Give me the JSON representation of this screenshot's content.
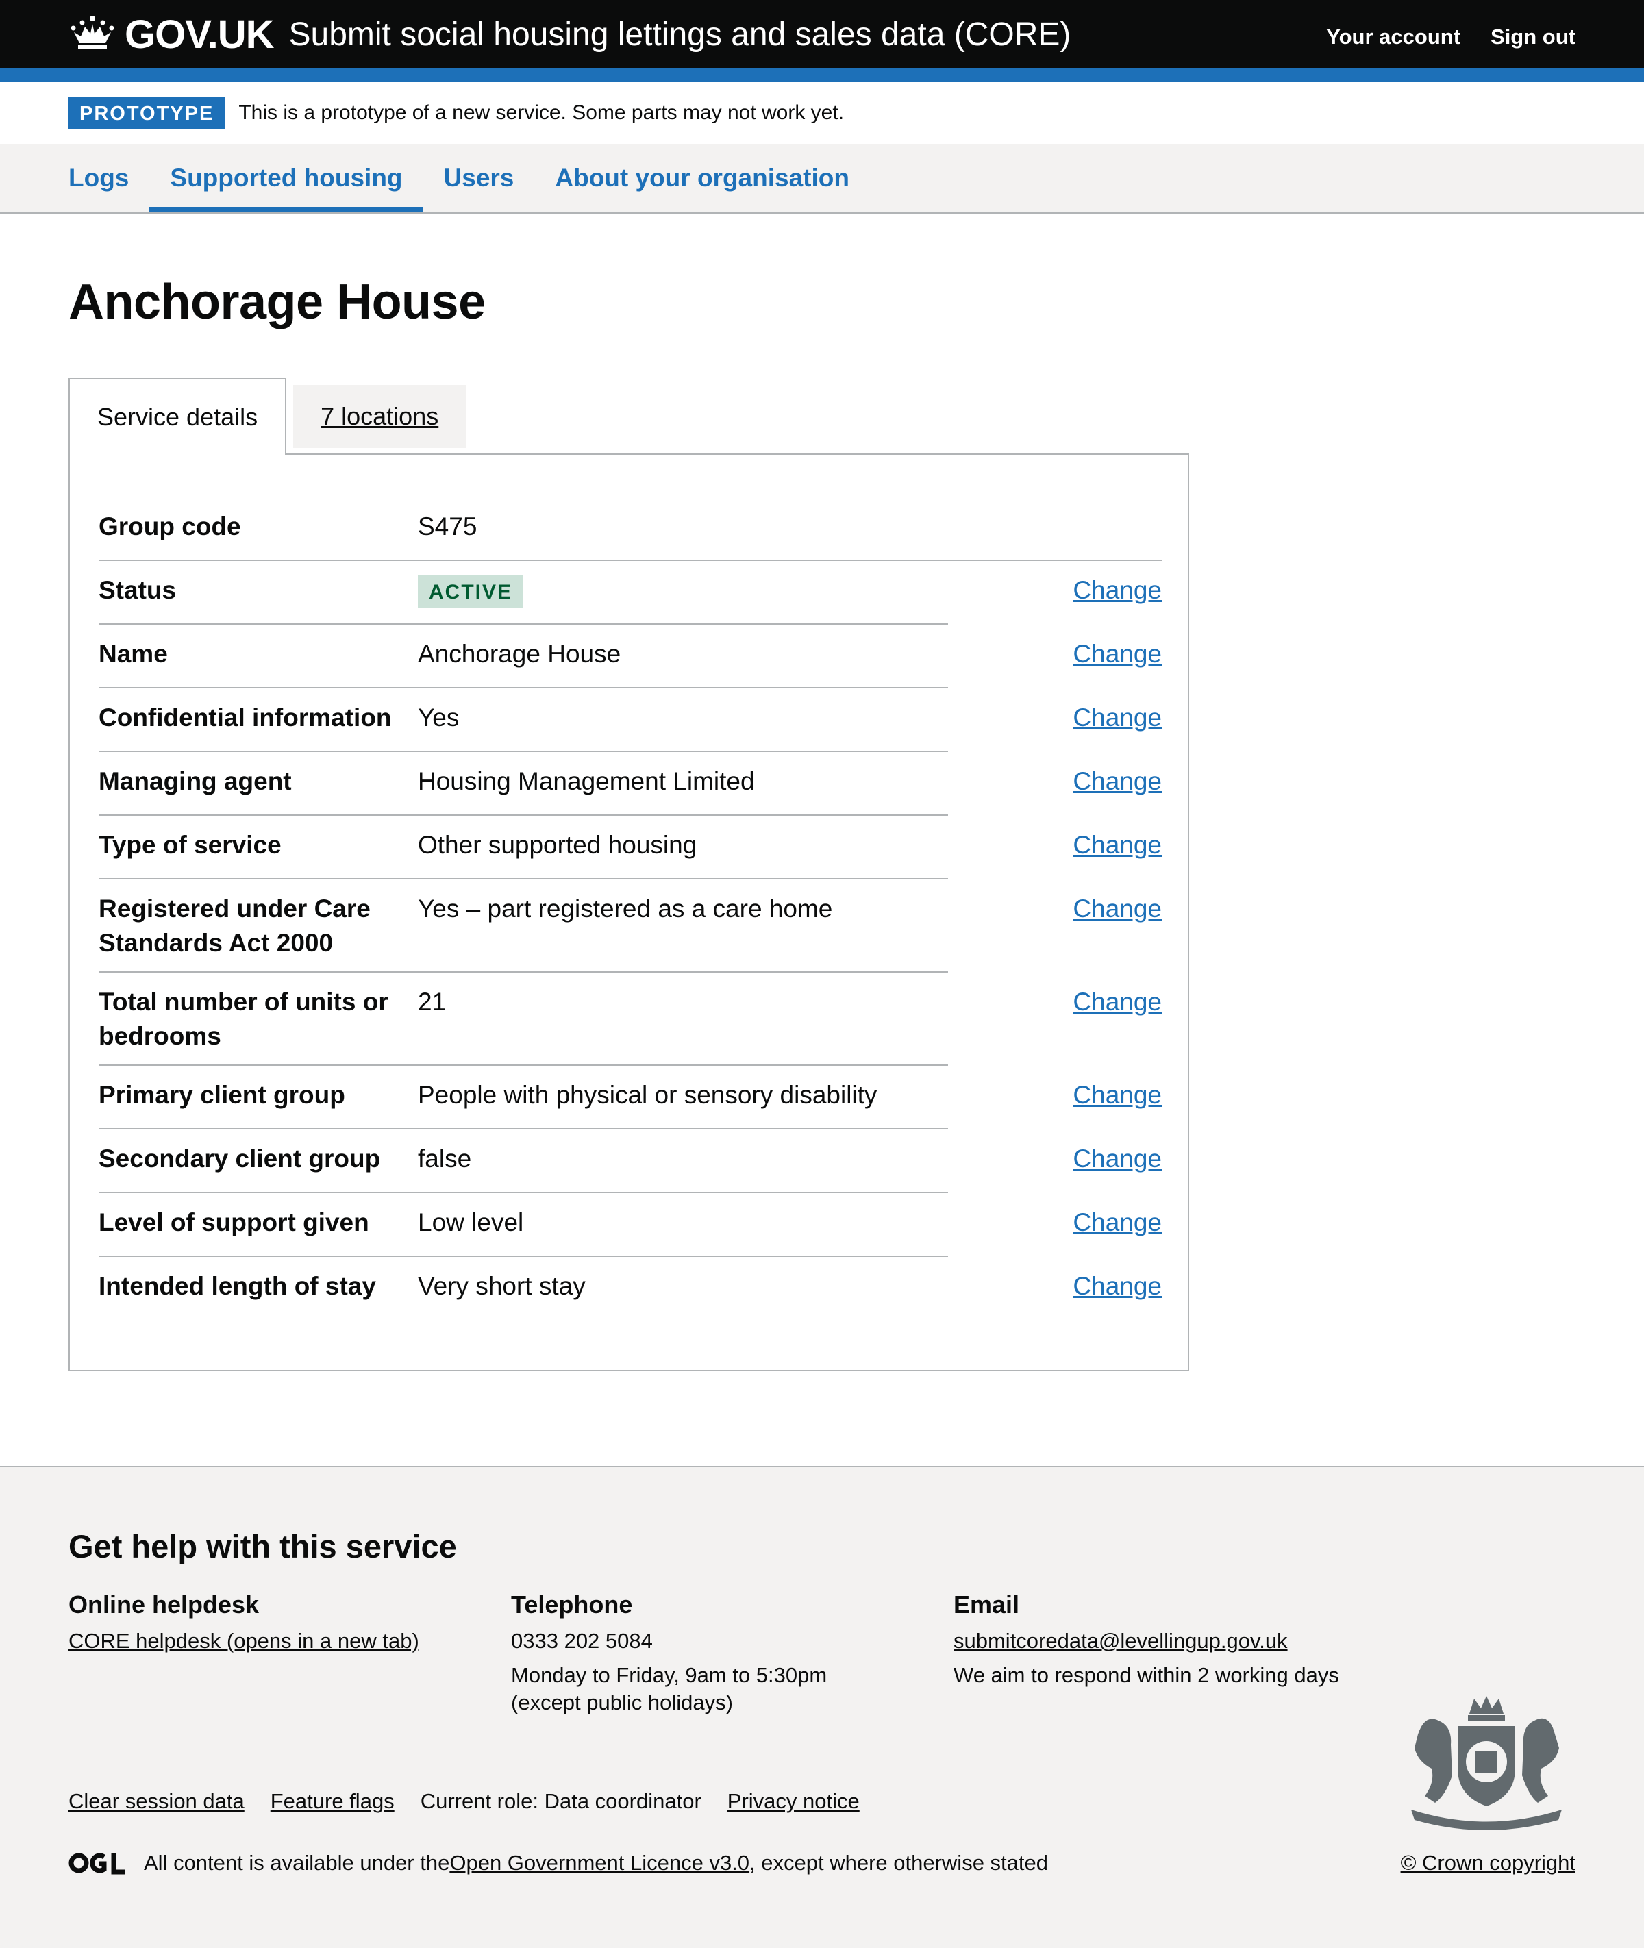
{
  "header": {
    "logo_text": "GOV.UK",
    "service_name": "Submit social housing lettings and sales data (CORE)",
    "links": [
      "Your account",
      "Sign out"
    ]
  },
  "phase": {
    "tag": "PROTOTYPE",
    "text": "This is a prototype of a new service. Some parts may not work yet."
  },
  "nav": {
    "items": [
      "Logs",
      "Supported housing",
      "Users",
      "About your organisation"
    ],
    "current": "Supported housing"
  },
  "page": {
    "title": "Anchorage House"
  },
  "tabs": {
    "selected": "Service details",
    "other": "7 locations"
  },
  "summary": {
    "change_label": "Change",
    "rows": [
      {
        "key": "Group code",
        "value": "S475"
      },
      {
        "key": "Status",
        "value": "ACTIVE"
      },
      {
        "key": "Name",
        "value": "Anchorage House"
      },
      {
        "key": "Confidential information",
        "value": "Yes"
      },
      {
        "key": "Managing agent",
        "value": "Housing Management Limited"
      },
      {
        "key": "Type of service",
        "value": "Other supported housing"
      },
      {
        "key": "Registered under Care Standards Act 2000",
        "value": "Yes – part registered as a care home"
      },
      {
        "key": "Total number of units or bedrooms",
        "value": "21"
      },
      {
        "key": "Primary client group",
        "value": "People with physical or sensory disability"
      },
      {
        "key": "Secondary client group",
        "value": "false"
      },
      {
        "key": "Level of support given",
        "value": "Low level"
      },
      {
        "key": "Intended length of stay",
        "value": "Very short stay"
      }
    ]
  },
  "footer": {
    "heading": "Get help with this service",
    "helpdesk": {
      "title": "Online helpdesk",
      "link": "CORE helpdesk (opens in a new tab)"
    },
    "telephone": {
      "title": "Telephone",
      "number": "0333 202 5084",
      "hours_line1": "Monday to Friday, 9am to 5:30pm",
      "hours_line2": "(except public holidays)"
    },
    "email": {
      "title": "Email",
      "address": "submitcoredata@levellingup.gov.uk",
      "note": "We aim to respond within 2 working days"
    },
    "meta": {
      "clear_session": "Clear session data",
      "feature_flags": "Feature flags",
      "current_role": "Current role: Data coordinator",
      "privacy": "Privacy notice"
    },
    "licence": {
      "prefix": "All content is available under the ",
      "link": "Open Government Licence v3.0",
      "suffix": ", except where otherwise stated"
    },
    "copyright": "© Crown copyright"
  },
  "colors": {
    "header_bg": "#0b0c0c",
    "brand_blue": "#1d70b8",
    "active_tag_bg": "#cce2d8",
    "active_tag_text": "#005a30",
    "footer_bg": "#f3f2f1"
  },
  "icons": [
    "crown-icon",
    "ogl-logo-icon",
    "royal-crest-icon"
  ]
}
